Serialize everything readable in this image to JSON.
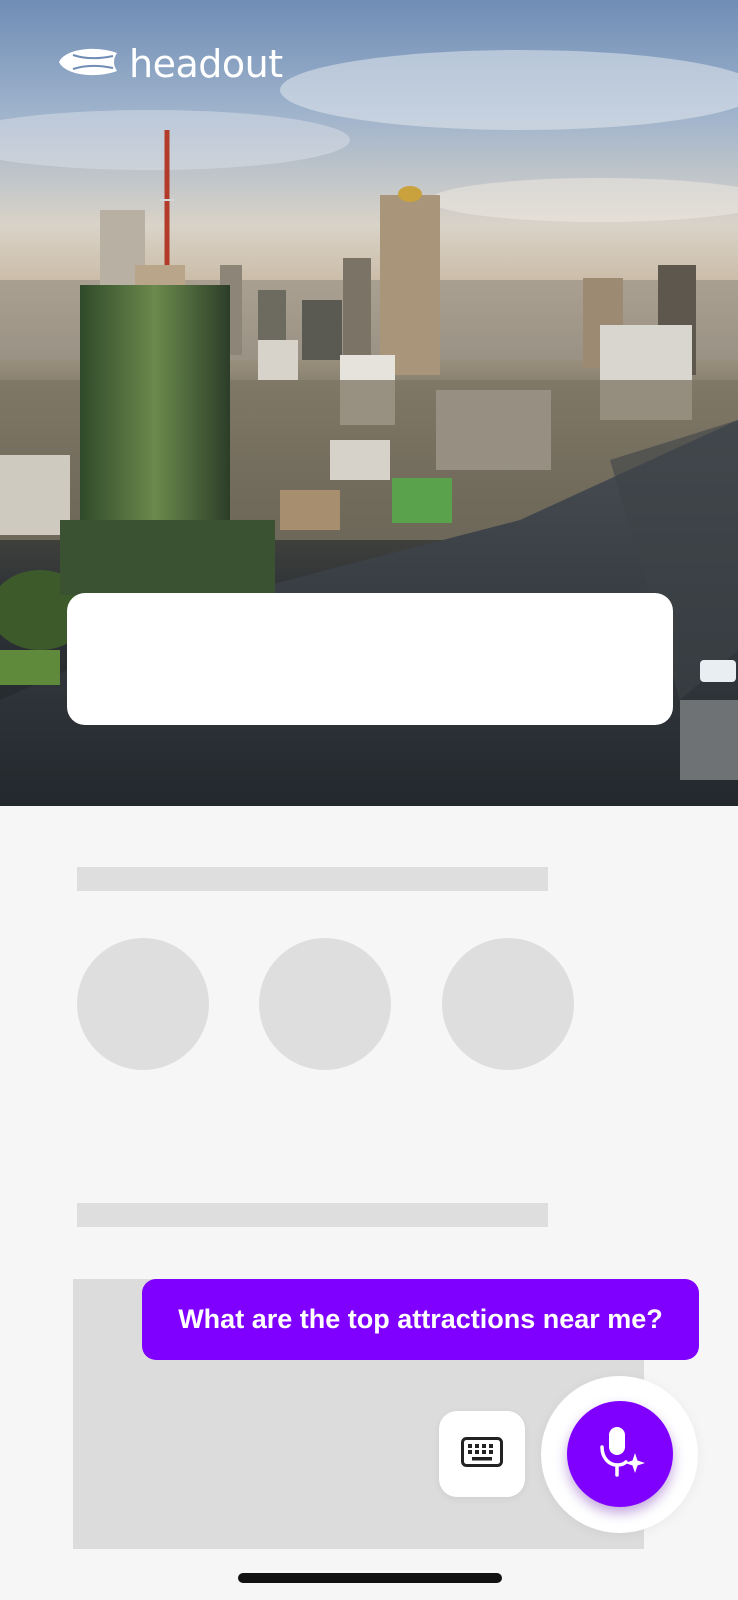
{
  "brand": {
    "name": "headout",
    "logo_icon": "blimp-icon"
  },
  "hero": {
    "image": "city-skyline-river-photo"
  },
  "chat": {
    "prompt": "What are the top attractions near me?"
  },
  "controls": {
    "keyboard_icon": "keyboard-icon",
    "mic_icon": "ai-microphone-icon"
  },
  "colors": {
    "accent": "#8000ff",
    "background": "#f6f6f6",
    "skeleton": "#dedede"
  }
}
